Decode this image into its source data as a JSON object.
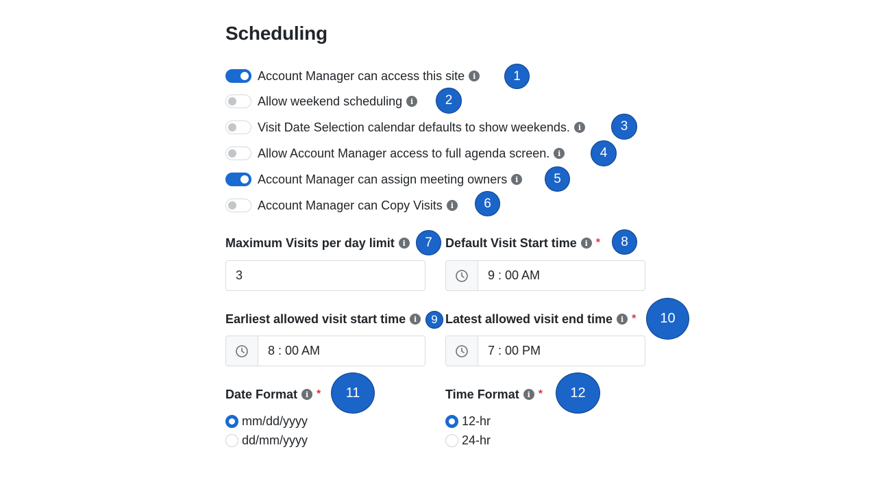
{
  "title": "Scheduling",
  "toggles": [
    {
      "label": "Account Manager can access this site",
      "on": true
    },
    {
      "label": "Allow weekend scheduling",
      "on": false
    },
    {
      "label": "Visit Date Selection calendar defaults to show weekends.",
      "on": false
    },
    {
      "label": "Allow Account Manager access to full agenda screen.",
      "on": false
    },
    {
      "label": "Account Manager can assign meeting owners",
      "on": true
    },
    {
      "label": "Account Manager can Copy Visits",
      "on": false
    }
  ],
  "info_icon": "info-circle-icon",
  "required_mark": "*",
  "fields": {
    "max_visits": {
      "label": "Maximum Visits per day limit",
      "value": "3"
    },
    "default_start": {
      "label": "Default Visit Start time",
      "value": "9 : 00 AM",
      "icon": "clock-icon"
    },
    "earliest_start": {
      "label": "Earliest allowed visit start time",
      "value": "8 : 00 AM",
      "icon": "clock-icon"
    },
    "latest_end": {
      "label": "Latest allowed visit end time",
      "value": "7 : 00 PM",
      "icon": "clock-icon"
    }
  },
  "date_format": {
    "label": "Date Format",
    "options": [
      "mm/dd/yyyy",
      "dd/mm/yyyy"
    ],
    "selected": "mm/dd/yyyy"
  },
  "time_format": {
    "label": "Time Format",
    "options": [
      "12-hr",
      "24-hr"
    ],
    "selected": "12-hr"
  },
  "callouts": [
    "1",
    "2",
    "3",
    "4",
    "5",
    "6",
    "7",
    "8",
    "9",
    "10",
    "11",
    "12"
  ],
  "colors": {
    "accent": "#1a6ad1",
    "callout": "#1b64c8",
    "required": "#dc3545",
    "info_icon": "#6b7075"
  }
}
